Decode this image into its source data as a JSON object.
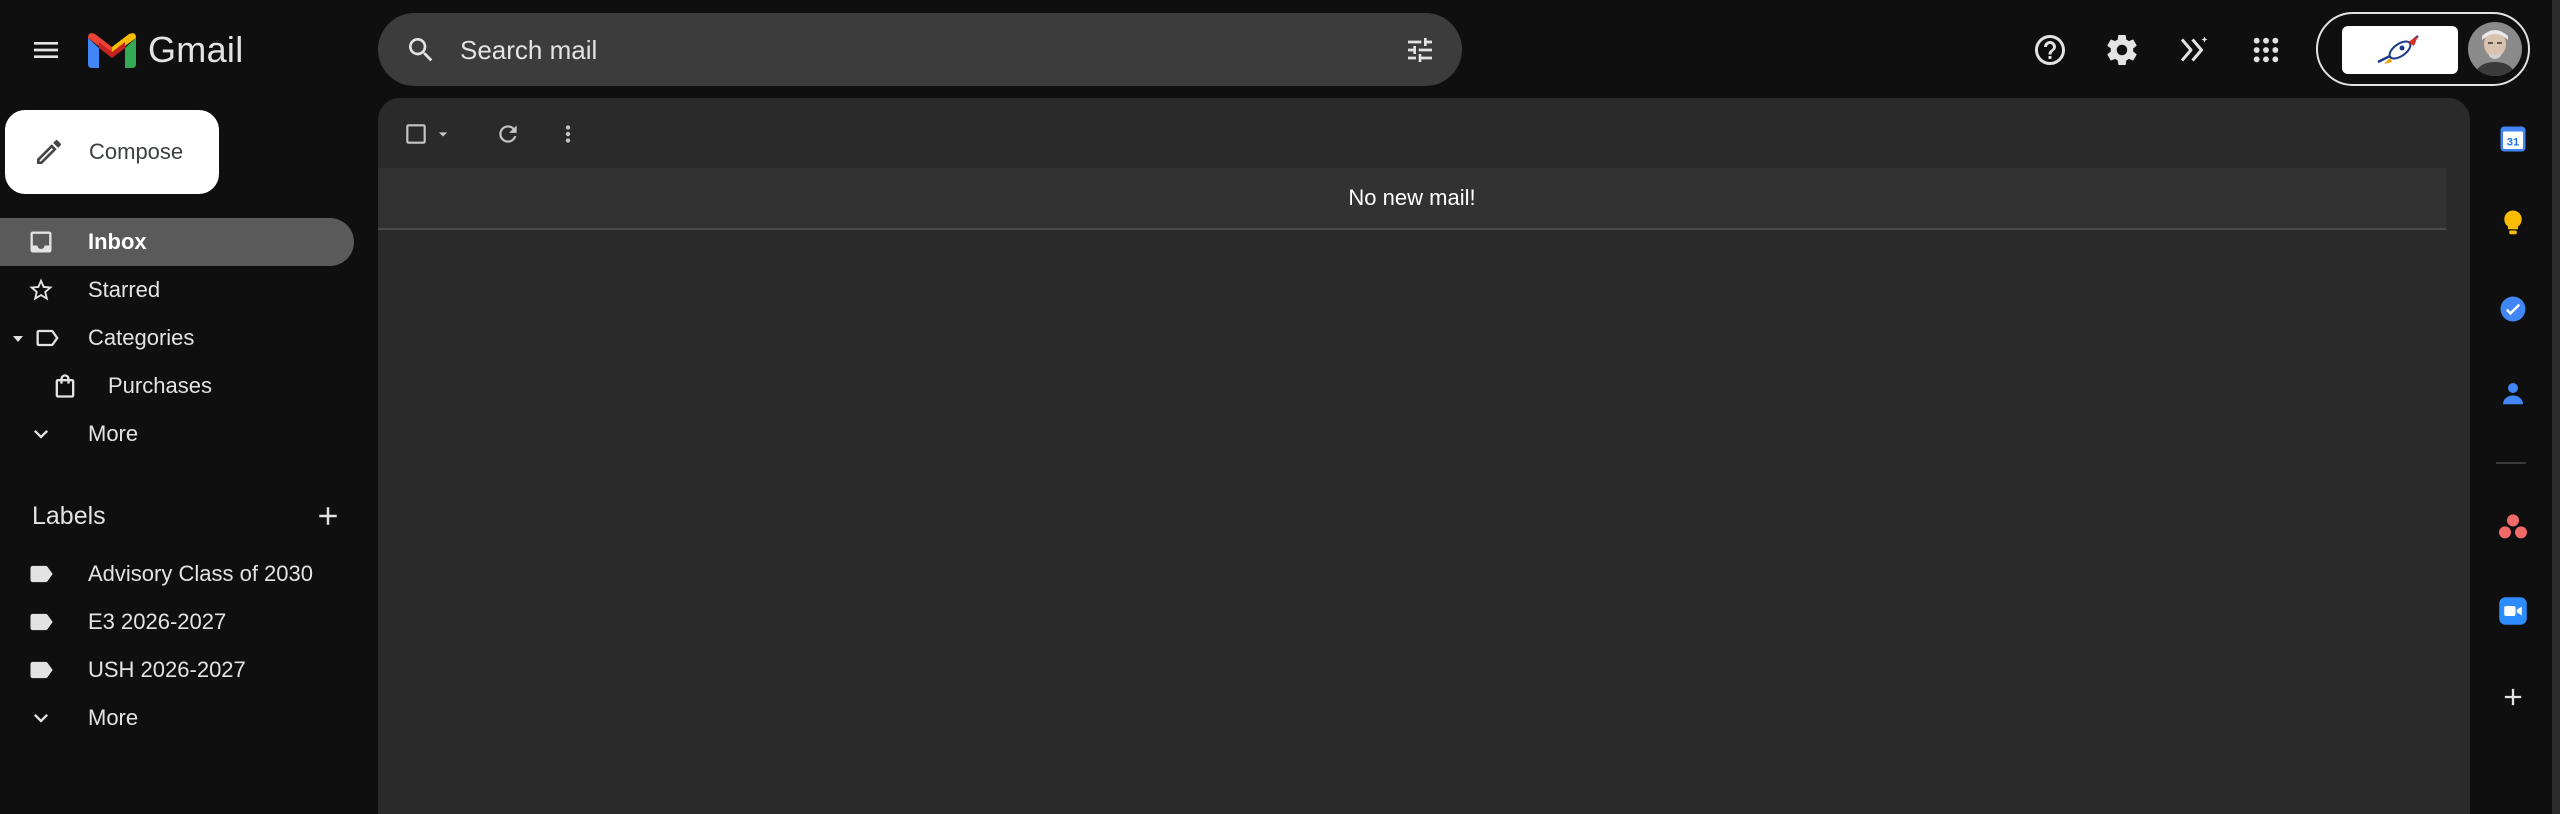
{
  "app": {
    "name": "Gmail"
  },
  "search": {
    "placeholder": "Search mail"
  },
  "compose": {
    "label": "Compose"
  },
  "nav": {
    "items": [
      {
        "label": "Inbox",
        "icon": "inbox-icon",
        "active": true
      },
      {
        "label": "Starred",
        "icon": "star-icon"
      },
      {
        "label": "Categories",
        "icon": "label-outline-icon"
      },
      {
        "label": "Purchases",
        "icon": "shopping-bag-icon"
      },
      {
        "label": "More",
        "icon": "chevron-down-icon"
      }
    ]
  },
  "labels": {
    "title": "Labels",
    "items": [
      {
        "label": "Advisory Class of 2030",
        "icon": "label-icon"
      },
      {
        "label": "E3 2026-2027",
        "icon": "label-icon"
      },
      {
        "label": "USH 2026-2027",
        "icon": "label-icon"
      }
    ],
    "more": "More"
  },
  "mail_list": {
    "empty_message": "No new mail!"
  },
  "side_panel": {
    "apps": [
      "calendar-icon",
      "keep-icon",
      "tasks-icon",
      "contacts-icon",
      "asana-icon",
      "zoom-icon",
      "add-icon"
    ],
    "calendar_day": "31"
  },
  "colors": {
    "background": "#0f0f0f",
    "surface": "#2a2a2a",
    "search": "#3c3c3c",
    "active_nav": "#5a5a5a",
    "gmail_red": "#EA4335",
    "gmail_blue": "#4285F4",
    "gmail_yellow": "#FBBC04",
    "gmail_green": "#34A853"
  }
}
